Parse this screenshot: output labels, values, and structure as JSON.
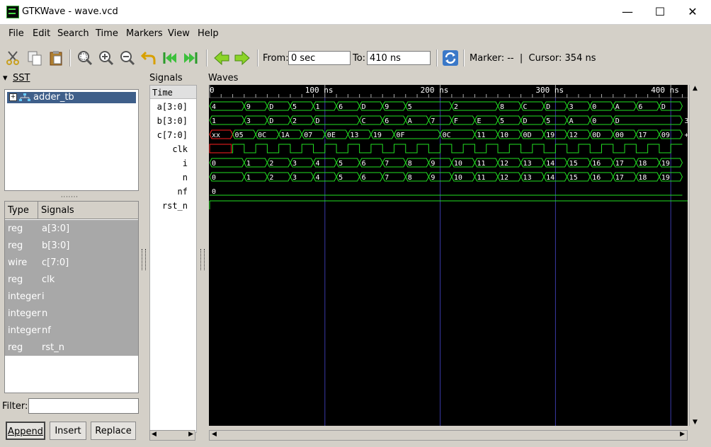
{
  "window": {
    "title": "GTKWave - wave.vcd"
  },
  "menu": [
    "File",
    "Edit",
    "Search",
    "Time",
    "Markers",
    "View",
    "Help"
  ],
  "toolbar": {
    "from_label": "From:",
    "from_value": "0 sec",
    "to_label": "To:",
    "to_value": "410 ns",
    "marker_text": "Marker: --  |  Cursor: 354 ns",
    "icons": [
      "cut-icon",
      "copy-icon",
      "paste-icon",
      "zoom-fit-icon",
      "zoom-in-icon",
      "zoom-out-icon",
      "undo-icon",
      "first-icon",
      "last-icon",
      "back-icon",
      "forward-icon",
      "reload-icon"
    ]
  },
  "sst": {
    "label": "SST",
    "tree_item": "adder_tb",
    "columns": [
      "Type",
      "Signals"
    ],
    "rows": [
      {
        "type": "reg",
        "name": "a[3:0]"
      },
      {
        "type": "reg",
        "name": "b[3:0]"
      },
      {
        "type": "wire",
        "name": "c[7:0]"
      },
      {
        "type": "reg",
        "name": "clk"
      },
      {
        "type": "integer",
        "name": "i"
      },
      {
        "type": "integer",
        "name": "n"
      },
      {
        "type": "integer",
        "name": "nf"
      },
      {
        "type": "reg",
        "name": "rst_n"
      }
    ],
    "filter_label": "Filter:",
    "buttons": [
      "Append",
      "Insert",
      "Replace"
    ]
  },
  "signals_pane": {
    "label": "Signals",
    "time_header": "Time",
    "names": [
      "a[3:0]",
      "b[3:0]",
      "c[7:0]",
      "clk",
      "i",
      "n",
      "nf",
      "rst_n"
    ]
  },
  "waves_pane": {
    "label": "Waves",
    "time_scale": {
      "start": 0,
      "end": 410,
      "unit": "ns",
      "labels": [
        "0",
        "100 ns",
        "200 ns",
        "300 ns",
        "400 ns"
      ],
      "label_times": [
        0,
        100,
        200,
        300,
        400
      ]
    },
    "colors": {
      "wave": "#22e022",
      "grid": "#3a3aa8",
      "text": "#ffffff",
      "unknown": "#ff2020"
    },
    "buses": [
      {
        "signal": "a[3:0]",
        "times": [
          0,
          30,
          50,
          70,
          90,
          110,
          130,
          150,
          170,
          210,
          250,
          270,
          290,
          310,
          330,
          350,
          370,
          390,
          410
        ],
        "values": [
          "4",
          "9",
          "D",
          "5",
          "1",
          "6",
          "D",
          "9",
          "5",
          "2",
          "8",
          "C",
          "D",
          "3",
          "0",
          "A",
          "6",
          "D"
        ]
      },
      {
        "signal": "b[3:0]",
        "times": [
          0,
          30,
          50,
          70,
          90,
          130,
          150,
          170,
          190,
          210,
          230,
          250,
          270,
          290,
          310,
          330,
          350,
          410
        ],
        "values": [
          "1",
          "3",
          "D",
          "2",
          "D",
          "C",
          "6",
          "A",
          "7",
          "F",
          "E",
          "5",
          "D",
          "5",
          "A",
          "0",
          "D",
          "3"
        ]
      },
      {
        "signal": "c[7:0]",
        "times": [
          0,
          20,
          40,
          60,
          80,
          100,
          120,
          140,
          160,
          200,
          230,
          250,
          270,
          290,
          310,
          330,
          350,
          370,
          390,
          410
        ],
        "values": [
          "xx",
          "05",
          "0C",
          "1A",
          "07",
          "0E",
          "13",
          "19",
          "0F",
          "0C",
          "11",
          "10",
          "0D",
          "19",
          "12",
          "0D",
          "00",
          "17",
          "09",
          "+"
        ]
      },
      {
        "signal": "i",
        "times": [
          0,
          30,
          50,
          70,
          90,
          110,
          130,
          150,
          170,
          190,
          210,
          230,
          250,
          270,
          290,
          310,
          330,
          350,
          370,
          390,
          410
        ],
        "values": [
          "0",
          "1",
          "2",
          "3",
          "4",
          "5",
          "6",
          "7",
          "8",
          "9",
          "10",
          "11",
          "12",
          "13",
          "14",
          "15",
          "16",
          "17",
          "18",
          "19"
        ]
      },
      {
        "signal": "n",
        "times": [
          0,
          30,
          50,
          70,
          90,
          110,
          130,
          150,
          170,
          190,
          210,
          230,
          250,
          270,
          290,
          310,
          330,
          350,
          370,
          390,
          410
        ],
        "values": [
          "0",
          "1",
          "2",
          "3",
          "4",
          "5",
          "6",
          "7",
          "8",
          "9",
          "10",
          "11",
          "12",
          "13",
          "14",
          "15",
          "16",
          "17",
          "18",
          "19"
        ]
      },
      {
        "signal": "nf",
        "times": [
          0,
          410
        ],
        "values": [
          "0"
        ]
      }
    ],
    "clk": {
      "signal": "clk",
      "first_rise": 20,
      "half_period": 10
    },
    "rst_n": {
      "signal": "rst_n",
      "level": 1
    }
  }
}
